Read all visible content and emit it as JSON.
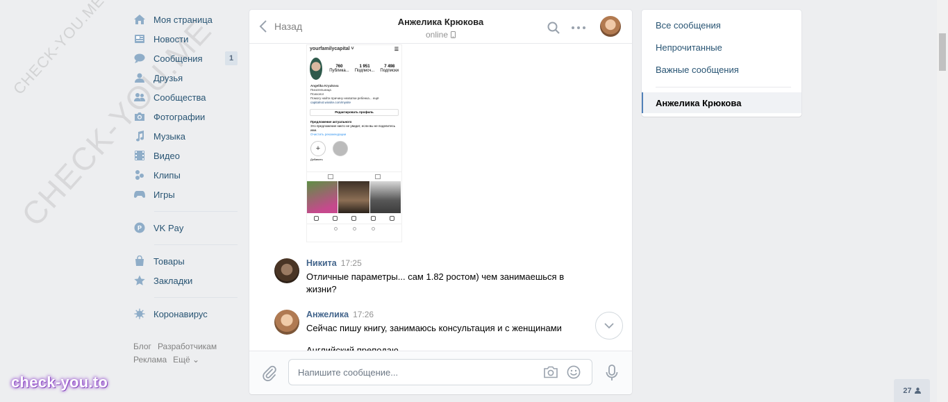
{
  "nav": {
    "items": [
      {
        "label": "Моя страница",
        "icon": "home-icon"
      },
      {
        "label": "Новости",
        "icon": "news-icon"
      },
      {
        "label": "Сообщения",
        "icon": "messages-icon",
        "badge": "1"
      },
      {
        "label": "Друзья",
        "icon": "friends-icon"
      },
      {
        "label": "Сообщества",
        "icon": "groups-icon"
      },
      {
        "label": "Фотографии",
        "icon": "camera-icon"
      },
      {
        "label": "Музыка",
        "icon": "music-icon"
      },
      {
        "label": "Видео",
        "icon": "video-icon"
      },
      {
        "label": "Клипы",
        "icon": "clips-icon"
      },
      {
        "label": "Игры",
        "icon": "games-icon"
      }
    ],
    "pay": {
      "label": "VK Pay",
      "icon": "vkpay-icon"
    },
    "extra": [
      {
        "label": "Товары",
        "icon": "bag-icon"
      },
      {
        "label": "Закладки",
        "icon": "star-icon"
      }
    ],
    "corona": {
      "label": "Коронавирус",
      "icon": "virus-icon"
    },
    "footer": {
      "blog": "Блог",
      "dev": "Разработчикам",
      "ads": "Реклама",
      "more": "Ещё ⌄"
    }
  },
  "watermark": {
    "small": "CHECK-YOU.ME",
    "large": "CHECK-YOU.ME",
    "brand": "check-you.to"
  },
  "chat": {
    "back_label": "Назад",
    "peer_name": "Анжелика Крюкова",
    "peer_status": "online",
    "phone": {
      "username": "yourfamilycapital ˅",
      "menu": "☰",
      "posts": "760",
      "posts_label": "Публика...",
      "followers": "1 951",
      "followers_label": "Подписч...",
      "following": "7 498",
      "following_label": "Подписки",
      "bio_name": "Angelika Kryukova",
      "bio_1": "Писательница",
      "bio_2": "Психолог",
      "bio_3": "Помогу найти причину нехватки ребенка... ещё",
      "bio_link": "capitalnot.wixsite.com/mysite",
      "edit": "Редактировать профиль",
      "sug_title": "Предложение актуального",
      "sug_text": "Это предложение никто не увидит, если вы не поделитесь ими.",
      "sug_link": "Очистить рекомендации",
      "add": "Добавить",
      "plus": "+"
    },
    "messages": [
      {
        "author": "Никита",
        "time": "17:25",
        "text": "Отличные параметры... сам 1.82 ростом) чем занимаешься в жизни?"
      },
      {
        "author": "Анжелика",
        "time": "17:26",
        "text": "Сейчас пишу книгу, занимаюсь консультация и с женщинами",
        "text2": "Английский преподаю"
      }
    ],
    "composer_placeholder": "Напишите сообщение..."
  },
  "right_menu": {
    "all": "Все сообщения",
    "unread": "Непрочитанные",
    "important": "Важные сообщения",
    "active": "Анжелика Крюкова"
  },
  "online_count": "27",
  "colors": {
    "accent": "#5181b8",
    "link": "#285473",
    "author": "#42648b",
    "bg": "#edeef0"
  }
}
